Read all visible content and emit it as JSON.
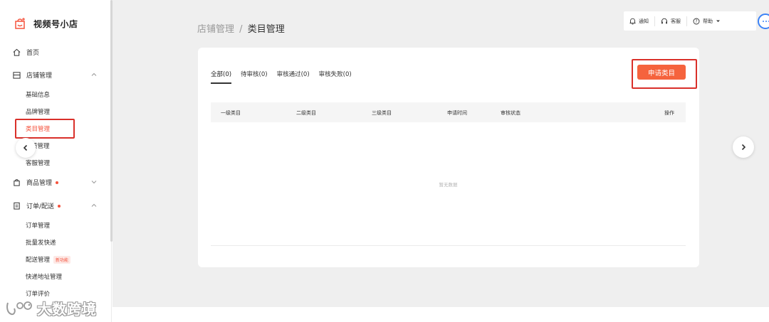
{
  "brand": {
    "name": "视频号小店",
    "icon": "shop-bag-icon",
    "accent": "#f5533d"
  },
  "sidebar": {
    "home": {
      "label": "首页",
      "icon": "home-icon"
    },
    "store": {
      "label": "店铺管理",
      "icon": "store-icon",
      "expanded": true,
      "items": [
        "基础信息",
        "品牌管理",
        "类目管理",
        "资质管理",
        "客服管理"
      ],
      "partial_item_visible": "质管理"
    },
    "products": {
      "label": "商品管理",
      "icon": "bag-icon",
      "expanded": false,
      "has_dot": true
    },
    "orders": {
      "label": "订单/配送",
      "icon": "clipboard-icon",
      "expanded": true,
      "has_dot": true,
      "items": [
        "订单管理",
        "批量发快递",
        "配送管理",
        "快递地址管理",
        "订单评价"
      ],
      "new_badge": "新功能"
    }
  },
  "breadcrumb": {
    "parent": "店铺管理",
    "separator": "/",
    "current": "类目管理"
  },
  "topbar": {
    "notify": "通知",
    "service": "客服",
    "help": "帮助",
    "icons": [
      "bell-icon",
      "headset-icon",
      "help-icon"
    ]
  },
  "tabs": [
    {
      "label": "全部(0)",
      "active": true
    },
    {
      "label": "待审核(0)",
      "active": false
    },
    {
      "label": "审核通过(0)",
      "active": false
    },
    {
      "label": "审核失败(0)",
      "active": false
    }
  ],
  "apply_button": {
    "label": "申请类目",
    "color": "#f5633d"
  },
  "table": {
    "columns": [
      "一级类目",
      "二级类目",
      "三级类目",
      "申请时间",
      "审核状态",
      "操作"
    ],
    "rows": [],
    "empty_text": "暂无数据"
  },
  "highlight_color": "#d9302a",
  "watermark": {
    "text": "大数跨境"
  }
}
